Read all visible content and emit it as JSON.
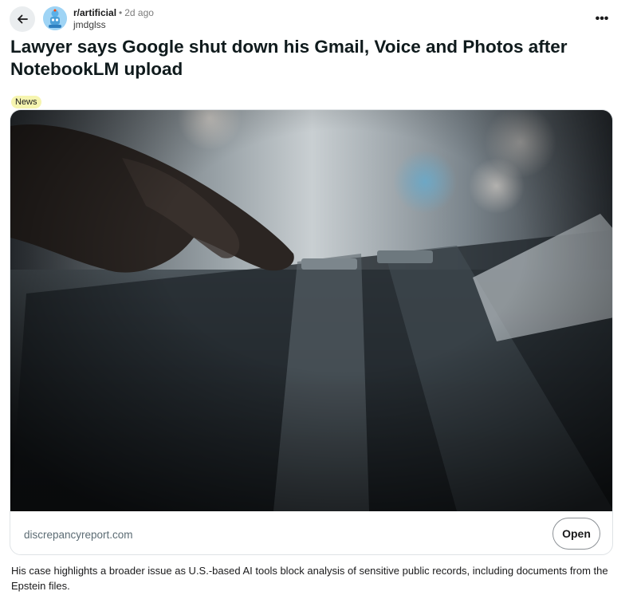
{
  "post": {
    "subreddit": "r/artificial",
    "separator": "•",
    "age": "2d ago",
    "author": "jmdglss",
    "title": "Lawyer says Google shut down his Gmail, Voice and Photos after NotebookLM upload",
    "flair": "News",
    "link_domain": "discrepancyreport.com",
    "open_label": "Open",
    "more_label": "•••",
    "body": "His case highlights a broader issue as U.S.-based AI tools block analysis of sensitive public records, including documents from the Epstein files."
  },
  "icons": {
    "back": "arrow-left-icon",
    "avatar": "subreddit-avatar-icon",
    "more": "more-options-icon"
  },
  "colors": {
    "flair_bg": "#f6f5b0",
    "back_bg": "#eaedef",
    "avatar_bg": "#9fd4f5"
  }
}
